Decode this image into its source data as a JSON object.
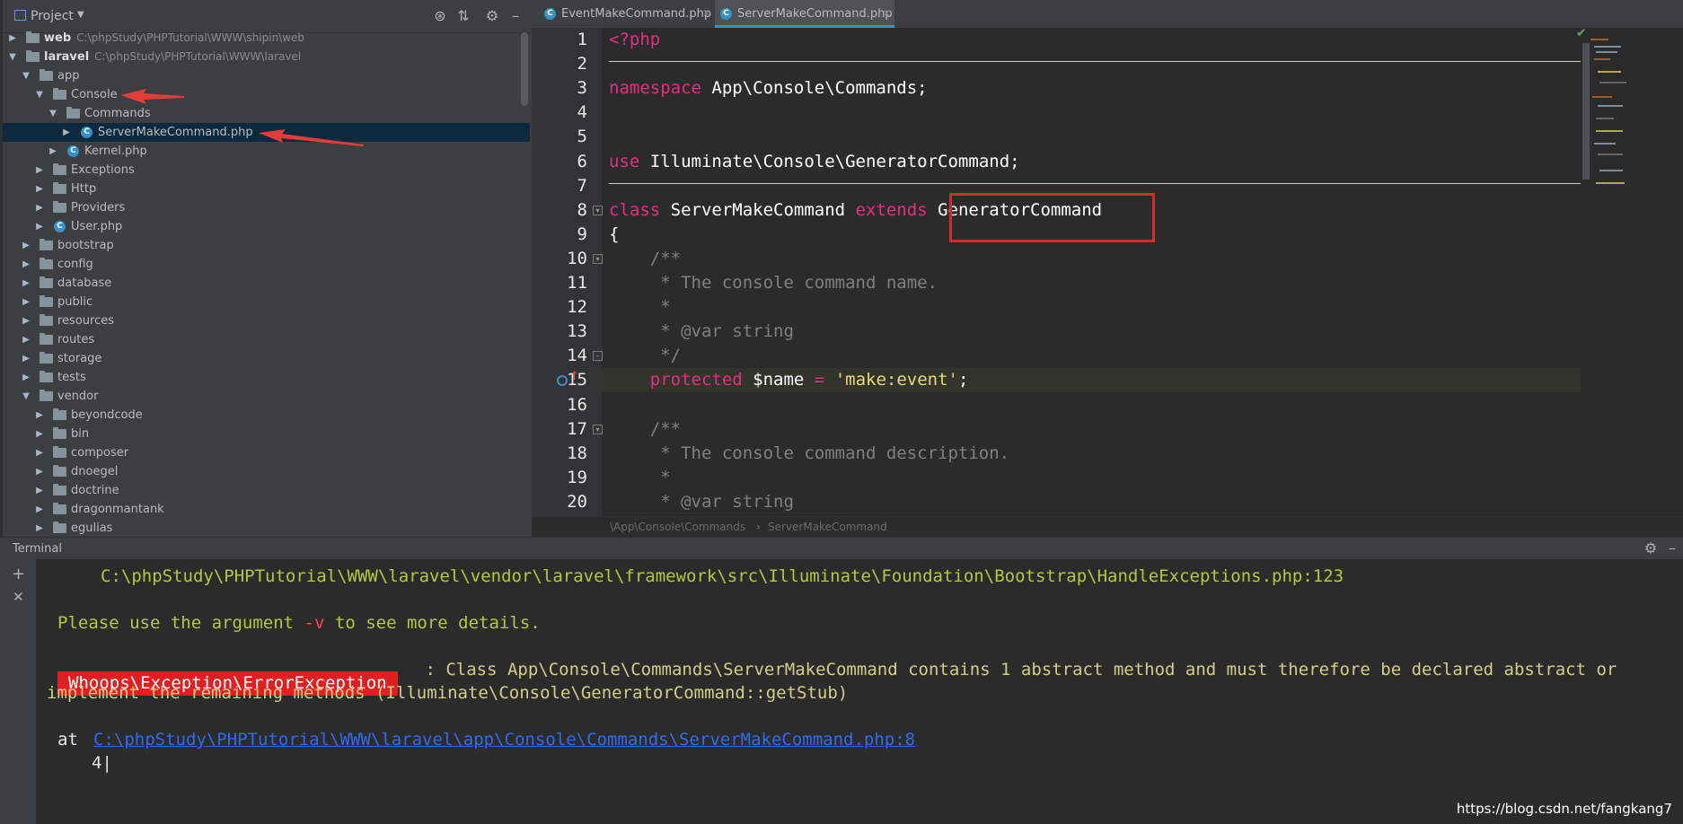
{
  "project": {
    "title": "Project",
    "tree": [
      {
        "label": "web",
        "path": "C:\\phpStudy\\PHPTutorial\\WWW\\shipin\\web",
        "type": "folder",
        "depth": 0,
        "expanded": false,
        "bold": true
      },
      {
        "label": "laravel",
        "path": "C:\\phpStudy\\PHPTutorial\\WWW\\laravel",
        "type": "folder",
        "depth": 0,
        "expanded": true,
        "bold": true
      },
      {
        "label": "app",
        "type": "folder",
        "depth": 1,
        "expanded": true
      },
      {
        "label": "Console",
        "type": "folder",
        "depth": 2,
        "expanded": true
      },
      {
        "label": "Commands",
        "type": "folder",
        "depth": 3,
        "expanded": true
      },
      {
        "label": "ServerMakeCommand.php",
        "type": "class",
        "depth": 4,
        "expanded": false,
        "selected": true
      },
      {
        "label": "Kernel.php",
        "type": "class",
        "depth": 3,
        "expanded": false
      },
      {
        "label": "Exceptions",
        "type": "folder",
        "depth": 2,
        "expanded": false
      },
      {
        "label": "Http",
        "type": "folder",
        "depth": 2,
        "expanded": false
      },
      {
        "label": "Providers",
        "type": "folder",
        "depth": 2,
        "expanded": false
      },
      {
        "label": "User.php",
        "type": "class",
        "depth": 2,
        "expanded": false
      },
      {
        "label": "bootstrap",
        "type": "folder",
        "depth": 1,
        "expanded": false
      },
      {
        "label": "config",
        "type": "folder",
        "depth": 1,
        "expanded": false
      },
      {
        "label": "database",
        "type": "folder",
        "depth": 1,
        "expanded": false
      },
      {
        "label": "public",
        "type": "folder",
        "depth": 1,
        "expanded": false
      },
      {
        "label": "resources",
        "type": "folder",
        "depth": 1,
        "expanded": false
      },
      {
        "label": "routes",
        "type": "folder",
        "depth": 1,
        "expanded": false
      },
      {
        "label": "storage",
        "type": "folder",
        "depth": 1,
        "expanded": false
      },
      {
        "label": "tests",
        "type": "folder",
        "depth": 1,
        "expanded": false
      },
      {
        "label": "vendor",
        "type": "folder",
        "depth": 1,
        "expanded": true
      },
      {
        "label": "beyondcode",
        "type": "folder",
        "depth": 2,
        "expanded": false
      },
      {
        "label": "bin",
        "type": "folder",
        "depth": 2,
        "expanded": false
      },
      {
        "label": "composer",
        "type": "folder",
        "depth": 2,
        "expanded": false
      },
      {
        "label": "dnoegel",
        "type": "folder",
        "depth": 2,
        "expanded": false
      },
      {
        "label": "doctrine",
        "type": "folder",
        "depth": 2,
        "expanded": false
      },
      {
        "label": "dragonmantank",
        "type": "folder",
        "depth": 2,
        "expanded": false
      },
      {
        "label": "egulias",
        "type": "folder",
        "depth": 2,
        "expanded": false
      }
    ]
  },
  "tabs": [
    {
      "label": "EventMakeCommand.php",
      "active": false
    },
    {
      "label": "ServerMakeCommand.php",
      "active": true
    }
  ],
  "code": {
    "line_numbers": [
      "1",
      "2",
      "3",
      "4",
      "5",
      "6",
      "7",
      "8",
      "9",
      "10",
      "11",
      "12",
      "13",
      "14",
      "15",
      "16",
      "17",
      "18",
      "19",
      "20"
    ],
    "lines": [
      [
        {
          "t": "<?php",
          "c": "kw2"
        }
      ],
      [],
      [
        {
          "t": "namespace ",
          "c": "kw2"
        },
        {
          "t": "App\\Console\\Commands;",
          "c": "ph"
        }
      ],
      [],
      [],
      [
        {
          "t": "use ",
          "c": "kw2"
        },
        {
          "t": "Illuminate\\Console\\GeneratorCommand;",
          "c": "ph"
        }
      ],
      [],
      [
        {
          "t": "class ",
          "c": "kw2"
        },
        {
          "t": "ServerMakeCommand ",
          "c": "ph"
        },
        {
          "t": "extends ",
          "c": "kw2"
        },
        {
          "t": "GeneratorCommand",
          "c": "ph"
        }
      ],
      [
        {
          "t": "{",
          "c": "ph"
        }
      ],
      [
        {
          "t": "    /**",
          "c": "cm"
        }
      ],
      [
        {
          "t": "     * The console command name.",
          "c": "cm"
        }
      ],
      [
        {
          "t": "     *",
          "c": "cm"
        }
      ],
      [
        {
          "t": "     * @var string",
          "c": "cm"
        }
      ],
      [
        {
          "t": "     */",
          "c": "cm"
        }
      ],
      [
        {
          "t": "    protected ",
          "c": "kw2"
        },
        {
          "t": "$name ",
          "c": "ph"
        },
        {
          "t": "= ",
          "c": "kw2"
        },
        {
          "t": "'make:event'",
          "c": "strY"
        },
        {
          "t": ";",
          "c": "ph"
        }
      ],
      [],
      [
        {
          "t": "    /**",
          "c": "cm"
        }
      ],
      [
        {
          "t": "     * The console command description.",
          "c": "cm"
        }
      ],
      [
        {
          "t": "     *",
          "c": "cm"
        }
      ],
      [
        {
          "t": "     * @var string",
          "c": "cm"
        }
      ]
    ]
  },
  "breadcrumb": {
    "namespace": "\\App\\Console\\Commands",
    "separator": "›",
    "class": "ServerMakeCommand"
  },
  "terminal": {
    "title": "Terminal",
    "path_line": "C:\\phpStudy\\PHPTutorial\\WWW\\laravel\\vendor\\laravel\\framework\\src\\Illuminate\\Foundation\\Bootstrap\\HandleExceptions.php:123",
    "hint_pre": "Please use the argument ",
    "hint_flag": "-v",
    "hint_post": " to see more details.",
    "error_badge": "Whoops\\Exception\\ErrorException",
    "error_msg_1": " : Class App\\Console\\Commands\\ServerMakeCommand contains 1 abstract method and must therefore be declared abstract or",
    "error_msg_2": "implement the remaining methods (Illuminate\\Console\\GeneratorCommand::getStub)",
    "at_label": "at ",
    "at_link": "C:\\phpStudy\\PHPTutorial\\WWW\\laravel\\app\\Console\\Commands\\ServerMakeCommand.php:8",
    "code_ref": "4|"
  },
  "watermark": "https://blog.csdn.net/fangkang7",
  "colors": {
    "accent_red": "#e02020",
    "selection": "#0d293e"
  }
}
